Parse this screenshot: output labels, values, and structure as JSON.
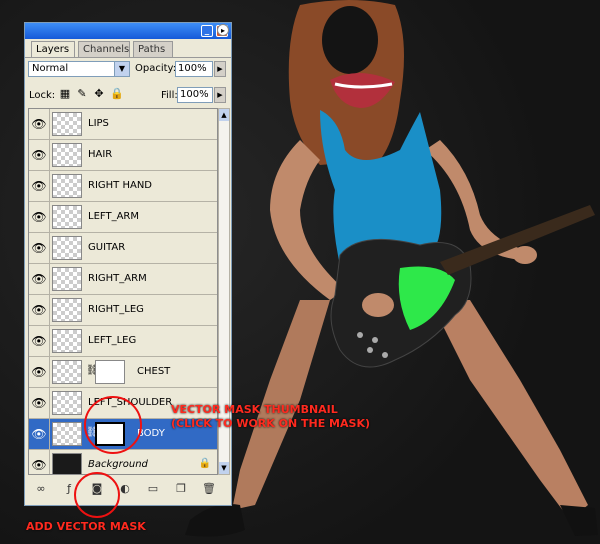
{
  "panel": {
    "tabs": [
      {
        "label": "Layers",
        "active": true
      },
      {
        "label": "Channels",
        "active": false
      },
      {
        "label": "Paths",
        "active": false
      }
    ],
    "blend_mode": "Normal",
    "opacity_label": "Opacity:",
    "opacity_value": "100%",
    "lock_label": "Lock:",
    "fill_label": "Fill:",
    "fill_value": "100%",
    "layers": [
      {
        "name": "LIPS",
        "visible": true,
        "mask": false,
        "selected": false
      },
      {
        "name": "HAIR",
        "visible": true,
        "mask": false,
        "selected": false
      },
      {
        "name": "RIGHT HAND",
        "visible": true,
        "mask": false,
        "selected": false
      },
      {
        "name": "LEFT_ARM",
        "visible": true,
        "mask": false,
        "selected": false
      },
      {
        "name": "GUITAR",
        "visible": true,
        "mask": false,
        "selected": false
      },
      {
        "name": "RIGHT_ARM",
        "visible": true,
        "mask": false,
        "selected": false
      },
      {
        "name": "RIGHT_LEG",
        "visible": true,
        "mask": false,
        "selected": false
      },
      {
        "name": "LEFT_LEG",
        "visible": true,
        "mask": false,
        "selected": false
      },
      {
        "name": "CHEST",
        "visible": true,
        "mask": true,
        "selected": false
      },
      {
        "name": "LEFT_SHOULDER",
        "visible": true,
        "mask": false,
        "selected": false
      },
      {
        "name": "BODY",
        "visible": true,
        "mask": true,
        "selected": true
      },
      {
        "name": "Background",
        "visible": true,
        "mask": false,
        "selected": false,
        "locked": true
      }
    ]
  },
  "annotations": {
    "vector_mask_line1": "VECTOR MASK THUMBNAIL",
    "vector_mask_line2": "(CLICK TO WORK ON THE MASK)",
    "add_vector_mask": "ADD VECTOR MASK"
  },
  "colors": {
    "accent": "#ff2a1f",
    "selection": "#316ac5",
    "titlebar": "#1559d8",
    "guitar_trim": "#2ee84a",
    "top": "#1a8fc7"
  },
  "icons": [
    "eye-icon",
    "link-icon",
    "fx-icon",
    "mask-icon",
    "adjustment-icon",
    "folder-icon",
    "new-layer-icon",
    "trash-icon",
    "lock-icon"
  ]
}
